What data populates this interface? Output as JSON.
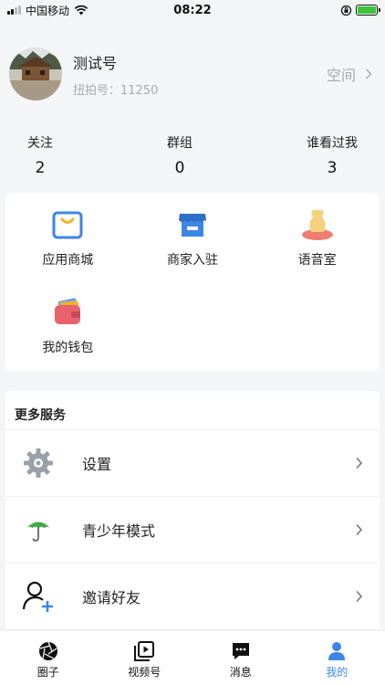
{
  "status_bar": {
    "carrier": "中国移动",
    "time": "08:22"
  },
  "profile": {
    "nickname": "测试号",
    "uid": "扭拍号：11250",
    "space_label": "空间"
  },
  "stats": [
    {
      "label": "关注",
      "value": "2"
    },
    {
      "label": "群组",
      "value": "0"
    },
    {
      "label": "谁看过我",
      "value": "3"
    }
  ],
  "grid": [
    {
      "label": "应用商城",
      "icon": "shopping-bag-icon"
    },
    {
      "label": "商家入驻",
      "icon": "storefront-icon"
    },
    {
      "label": "语音室",
      "icon": "voice-room-icon"
    },
    {
      "label": "我的钱包",
      "icon": "wallet-icon"
    }
  ],
  "services": {
    "title": "更多服务",
    "items": [
      {
        "label": "设置",
        "icon": "gear-icon"
      },
      {
        "label": "青少年模式",
        "icon": "umbrella-icon"
      },
      {
        "label": "邀请好友",
        "icon": "add-user-icon"
      }
    ]
  },
  "tabbar": {
    "items": [
      {
        "label": "圈子",
        "icon": "aperture-icon"
      },
      {
        "label": "视频号",
        "icon": "video-icon"
      },
      {
        "label": "消息",
        "icon": "message-icon"
      },
      {
        "label": "我的",
        "icon": "person-icon"
      }
    ],
    "active_color": "#3b86e6"
  }
}
